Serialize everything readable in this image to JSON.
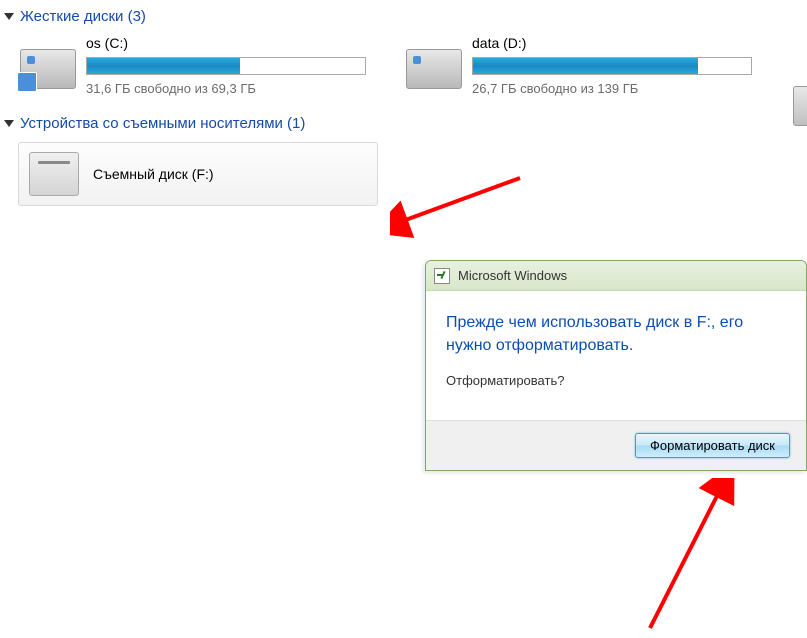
{
  "sections": {
    "hard_disks": {
      "title": "Жесткие диски (3)",
      "items": [
        {
          "label": "os (C:)",
          "free_text": "31,6 ГБ свободно из 69,3 ГБ",
          "fill_percent": 55
        },
        {
          "label": "data (D:)",
          "free_text": "26,7 ГБ свободно из 139 ГБ",
          "fill_percent": 81
        }
      ]
    },
    "removable": {
      "title": "Устройства со съемными носителями (1)",
      "items": [
        {
          "label": "Съемный диск (F:)"
        }
      ]
    }
  },
  "dialog": {
    "title": "Microsoft Windows",
    "main_text": "Прежде чем использовать диск в F:, его нужно отформатировать.",
    "question": "Отформатировать?",
    "button_format": "Форматировать диск"
  }
}
